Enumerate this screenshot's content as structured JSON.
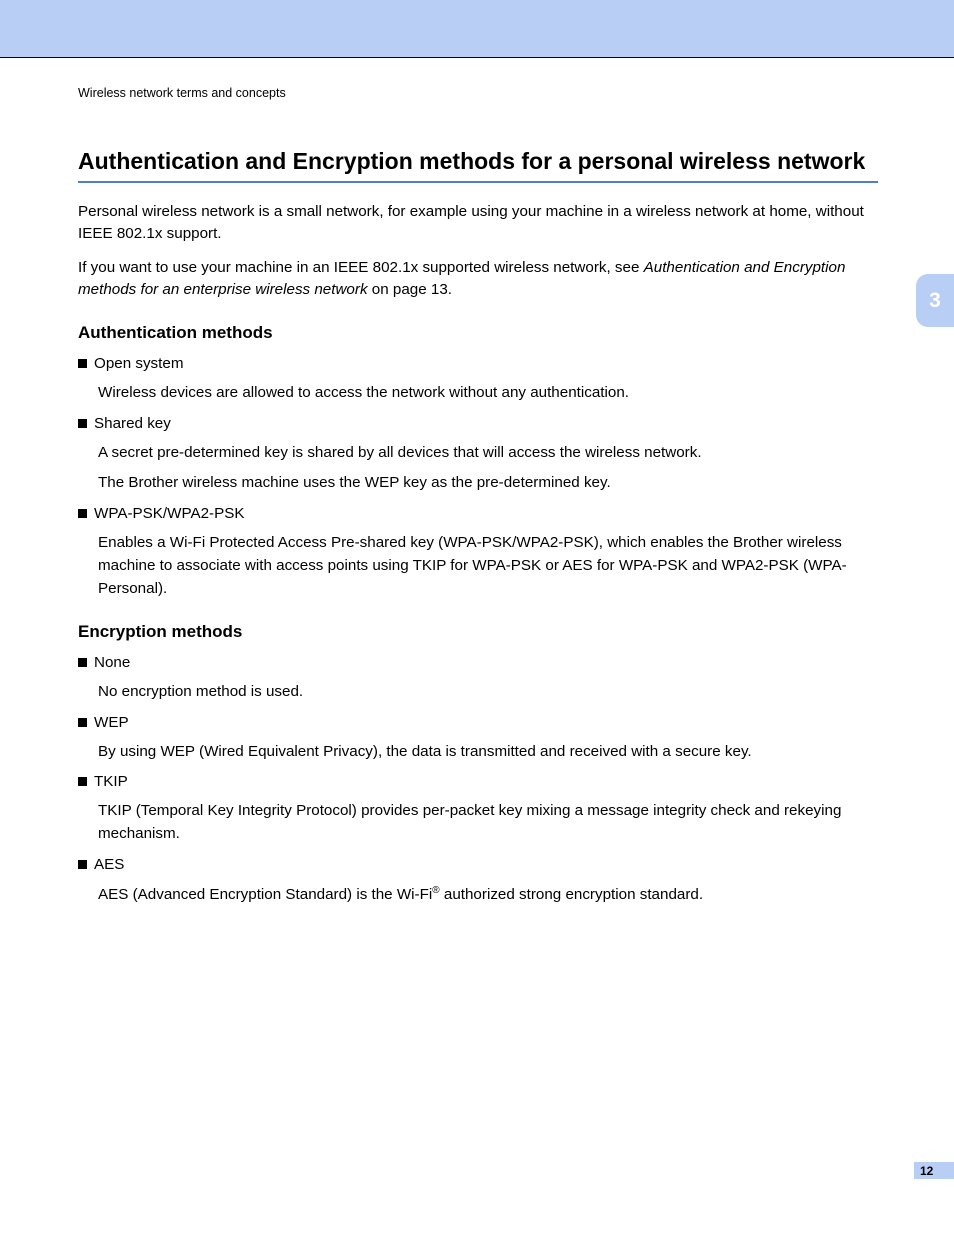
{
  "chapter_tab": "3",
  "page_number": "12",
  "running_head": "Wireless network terms and concepts",
  "title_prefix": "Authentication and Encryption methods for a personal wireless network",
  "intro_p1": "Personal wireless network is a small network, for example using your machine in a wireless network at home, without IEEE 802.1x support.",
  "intro_p2_a": "If you want to use your machine in an IEEE 802.1x supported wireless network, see ",
  "intro_p2_link": "Authentication and Encryption methods for an enterprise wireless network",
  "intro_p2_b": " on page 13.",
  "auth_heading": "Authentication methods",
  "auth_items": [
    {
      "name": "Open system",
      "desc": [
        "Wireless devices are allowed to access the network without any authentication."
      ]
    },
    {
      "name": "Shared key",
      "desc": [
        "A secret pre-determined key is shared by all devices that will access the wireless network.",
        "The Brother wireless machine uses the WEP key as the pre-determined key."
      ]
    },
    {
      "name": "WPA-PSK/WPA2-PSK",
      "desc": [
        "Enables a Wi-Fi Protected Access Pre-shared key (WPA-PSK/WPA2-PSK), which enables the Brother wireless machine to associate with access points using TKIP for WPA-PSK or AES for WPA-PSK and WPA2-PSK (WPA-Personal)."
      ]
    }
  ],
  "enc_heading": "Encryption methods",
  "enc_items": [
    {
      "name": "None",
      "desc": [
        "No encryption method is used."
      ]
    },
    {
      "name": "WEP",
      "desc": [
        "By using WEP (Wired Equivalent Privacy), the data is transmitted and received with a secure key."
      ]
    },
    {
      "name": "TKIP",
      "desc": [
        "TKIP (Temporal Key Integrity Protocol) provides per-packet key mixing a message integrity check and rekeying mechanism."
      ]
    },
    {
      "name": "AES",
      "desc_html": "AES (Advanced Encryption Standard) is the Wi-Fi<sup>®</sup> authorized strong encryption standard."
    }
  ]
}
